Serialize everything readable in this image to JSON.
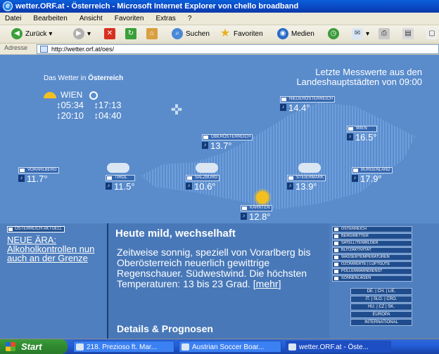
{
  "window": {
    "title": "wetter.ORF.at - Österreich - Microsoft Internet Explorer von chello broadband"
  },
  "menu": [
    "Datei",
    "Bearbeiten",
    "Ansicht",
    "Favoriten",
    "Extras",
    "?"
  ],
  "toolbar": {
    "back": "Zurück",
    "search": "Suchen",
    "favorites": "Favoriten",
    "media": "Medien"
  },
  "address": {
    "label": "Adresse",
    "url": "http://wetter.orf.at/oes/"
  },
  "weather": {
    "title_prefix": "Das Wetter in ",
    "title_bold": "Österreich",
    "latest_line1": "Letzte Messwerte aus den",
    "latest_line2": "Landeshauptstädten von 09:00",
    "wien": {
      "name": "WIEN",
      "sunrise": "↕05:34",
      "moonrise": "↕17:13",
      "sunset": "↕20:10",
      "moonset": "↕04:40"
    },
    "cities": [
      {
        "name": "NIEDERÖSTERREICH",
        "temp": "14.4°"
      },
      {
        "name": "OBERÖSTERREICH",
        "temp": "13.7°"
      },
      {
        "name": "WIEN",
        "temp": "16.5°"
      },
      {
        "name": "VORARLBERG",
        "temp": "11.7°"
      },
      {
        "name": "TIROL",
        "temp": "11.5°"
      },
      {
        "name": "SALZBURG",
        "temp": "10.6°"
      },
      {
        "name": "STEIERMARK",
        "temp": "13.9°"
      },
      {
        "name": "BURGENLAND",
        "temp": "17.9°"
      },
      {
        "name": "KÄRNTEN",
        "temp": "12.8°"
      }
    ]
  },
  "aktuell": {
    "tag": "ÖSTERREICH AKTUELL",
    "news": "NEUE ÄRA: Alkoholkontrollen nun auch an der Grenze"
  },
  "main": {
    "headline": "Heute mild, wechselhaft",
    "body": "Zeitweise sonnig, speziell von Vorarlberg bis Oberösterreich neuerlich gewittrige Regenschauer. Südwestwind. Die höchsten Temperaturen: 13 bis 23 Grad. ",
    "more": "mehr",
    "details": "Details & Prognosen"
  },
  "nav": [
    "ÖSTERREICH",
    "BERGWETTER",
    "SATELLITENBILDER",
    "BLITZAKTIVITÄT",
    "WASSERTEMPERATUREN",
    "OZONWERTE | LUFTGÜTE",
    "POLLENWARNDIENST",
    "SONNENLAGEN"
  ],
  "codes": [
    "DE. | CH. | LIE.",
    "IT. | SLO. | CRO.",
    "HU. | CZ | SK.",
    "EUROPA",
    "INTERNATIONAL"
  ],
  "taskbar": {
    "start": "Start",
    "tasks": [
      "218. Prezioso ft. Mar...",
      "Austrian Soccer Boar...",
      "wetter.ORF.at - Öste..."
    ]
  }
}
